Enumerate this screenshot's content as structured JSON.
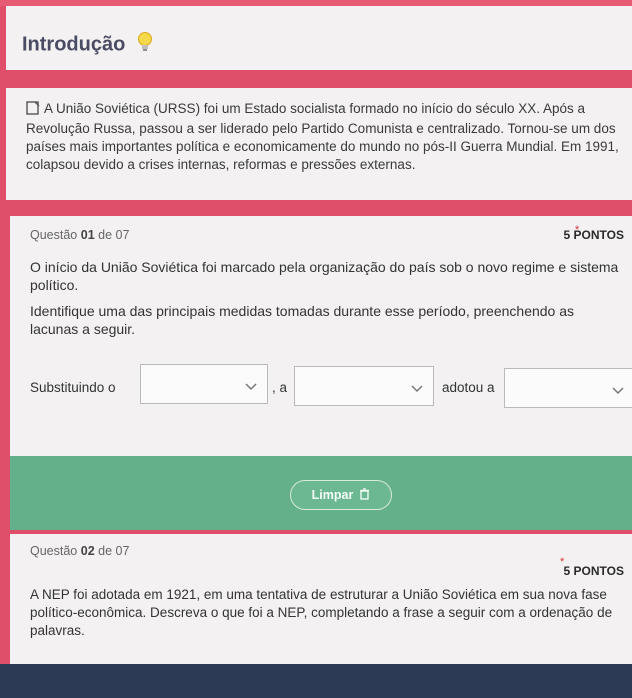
{
  "intro": {
    "title": "Introdução",
    "text": "A União Soviética (URSS) foi um Estado socialista formado no início do século XX. Após a Revolução Russa, passou a ser liderado pelo Partido Comunista e centralizado. Tornou-se um dos países mais importantes política e economicamente do mundo no pós-II Guerra Mundial. Em 1991, colapsou devido a crises internas, reformas e pressões externas."
  },
  "q1": {
    "label": "Questão",
    "number": "01",
    "of_text": "de 07",
    "points": "5 PONTOS",
    "prompt1": "O início da União Soviética foi marcado pela organização do país sob o novo regime e sistema político.",
    "prompt2": "Identifique uma das principais medidas tomadas durante esse período, preenchendo as lacunas a seguir.",
    "fill": {
      "part1": "Substituindo o",
      "part2": ", a",
      "part3": "adotou a"
    },
    "clear_label": "Limpar"
  },
  "q2": {
    "label": "Questão",
    "number": "02",
    "of_text": "de 07",
    "points": "5 PONTOS",
    "prompt": "A NEP foi adotada em 1921, em uma tentativa de estruturar a União Soviética em sua nova fase político-econômica. Descreva o que foi a NEP, completando a frase a seguir com a ordenação de palavras."
  },
  "colors": {
    "page_bg": "#e04f6a",
    "card_bg": "#f3f1f2",
    "action_bar": "#63b08a",
    "bottom_band": "#2c3a56"
  },
  "icons": [
    "lightbulb-icon",
    "document-icon",
    "chevron-down-icon",
    "trash-icon",
    "required-asterisk-icon"
  ]
}
